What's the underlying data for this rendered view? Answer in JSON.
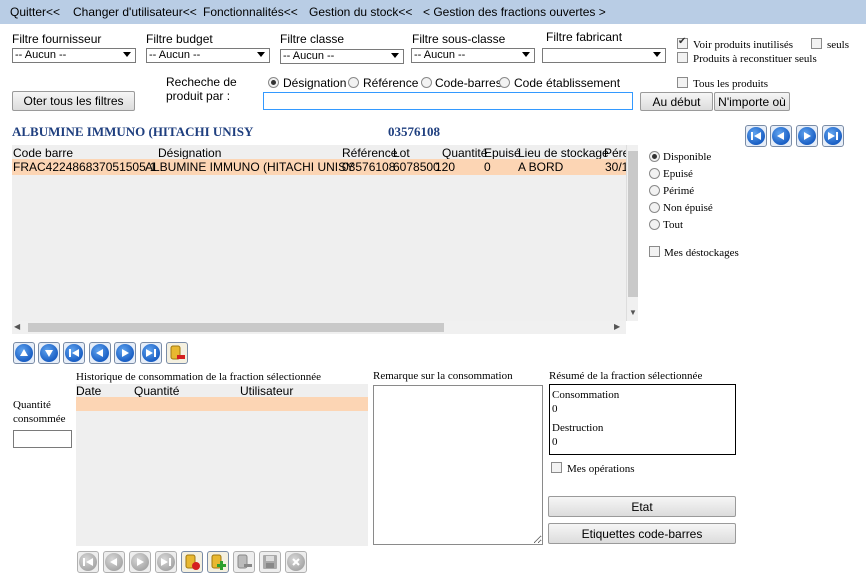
{
  "menu": [
    "Quitter<<",
    "Changer d'utilisateur<<",
    "Fonctionnalités<<",
    "Gestion du stock<<",
    "< Gestion des fractions ouvertes >"
  ],
  "filters": {
    "fournisseur_label": "Filtre fournisseur",
    "budget_label": "Filtre budget",
    "classe_label": "Filtre classe",
    "sousclasse_label": "Filtre sous-classe",
    "fabricant_label": "Filtre fabricant",
    "none": "-- Aucun --",
    "fabricant_value": ""
  },
  "options": {
    "voir_inutilises": "Voir produits inutilisés",
    "seuls": "seuls",
    "reconstituer": "Produits à reconstituer seuls",
    "tous_produits": "Tous les produits"
  },
  "search": {
    "label": "Recheche de produit par :",
    "modes": [
      "Désignation",
      "Référence",
      "Code-barres",
      "Code établissement"
    ],
    "value": "",
    "btn_debut": "Au début",
    "btn_nimporte": "N'importe où",
    "btn_reset": "Oter tous les filtres"
  },
  "product": {
    "name": "ALBUMINE IMMUNO (HITACHI UNISY",
    "code": "03576108"
  },
  "grid": {
    "headers": [
      "Code barre",
      "Désignation",
      "Référence",
      "Lot",
      "Quantité",
      "Epuisé",
      "Lieu de stockage",
      "Pére"
    ],
    "row": [
      "FRAC422486837051505-1",
      "ALBUMINE IMMUNO (HITACHI UNISY",
      "03576108",
      "6078500",
      "120",
      "0",
      "A BORD",
      "30/1"
    ]
  },
  "status_filter": [
    "Disponible",
    "Epuisé",
    "Périmé",
    "Non épuisé",
    "Tout"
  ],
  "mes_destockages": "Mes déstockages",
  "quantity": {
    "label": "Quantité consommée",
    "value": ""
  },
  "history": {
    "title": "Historique de consommation de la fraction sélectionnée",
    "headers": [
      "Date",
      "Quantité",
      "Utilisateur"
    ]
  },
  "remark": {
    "title": "Remarque sur la consommation",
    "value": ""
  },
  "summary": {
    "title": "Résumé de la fraction sélectionnée",
    "consommation_label": "Consommation",
    "consommation_value": "0",
    "destruction_label": "Destruction",
    "destruction_value": "0"
  },
  "mes_operations": "Mes opérations",
  "buttons": {
    "etat": "Etat",
    "etiquettes": "Etiquettes code-barres"
  },
  "colors": {
    "menubar": "#b9cde5",
    "selection": "#fcd5b4",
    "title": "#1f3f7f",
    "nav_blue": "#1a5fc4"
  }
}
